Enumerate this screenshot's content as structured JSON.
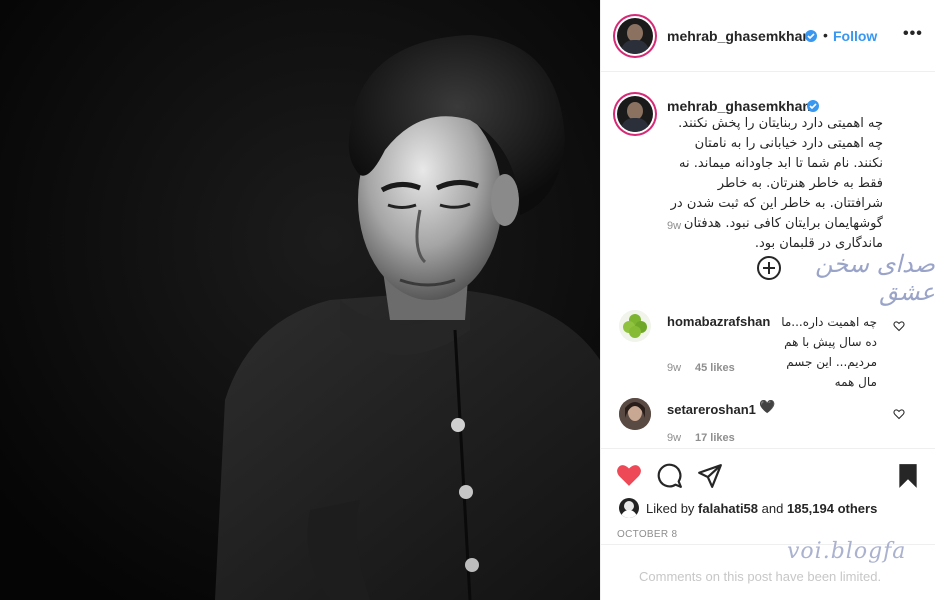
{
  "post": {
    "username": "mehrab_ghasemkhani",
    "follow_label": "Follow",
    "more_label": "•••",
    "caption": "چه اهمیتی دارد ربنایتان را پخش نکنند. چه اهمیتی دارد خیابانی را به نامتان نکنند. نام شما تا ابد جاودانه میماند. نه فقط به خاطر هنرتان. به خاطر شرافتتان. به خاطر این که ثبت شدن در گوشهایمان برایتان کافی نبود. هدفتان ماندگاری در قلبمان بود.",
    "caption_time": "9w",
    "overlay_text": "صدای سخن عشق"
  },
  "comments": [
    {
      "username": "homabazrafshan",
      "text": "چه اهمیت داره...ما ده سال پیش با هم مردیم... این جسم مال همه",
      "time": "9w",
      "likes": "45 likes"
    },
    {
      "username": "setareroshan1",
      "text": "🖤",
      "time": "9w",
      "likes": "17 likes"
    }
  ],
  "liked_by": {
    "prefix": "Liked by",
    "user": "falahati58",
    "and": "and",
    "count": "185,194 others"
  },
  "date": "OCTOBER 8",
  "footer": {
    "limited": "Comments on this post have been limited.",
    "watermark": "voi.blogfa"
  },
  "icons": {
    "like": "heart-filled-icon",
    "comment": "comment-icon",
    "share": "paper-plane-icon",
    "save": "bookmark-filled-icon"
  },
  "colors": {
    "accent": "#3897f0",
    "heart": "#ed4956",
    "ring": "#d62976"
  }
}
